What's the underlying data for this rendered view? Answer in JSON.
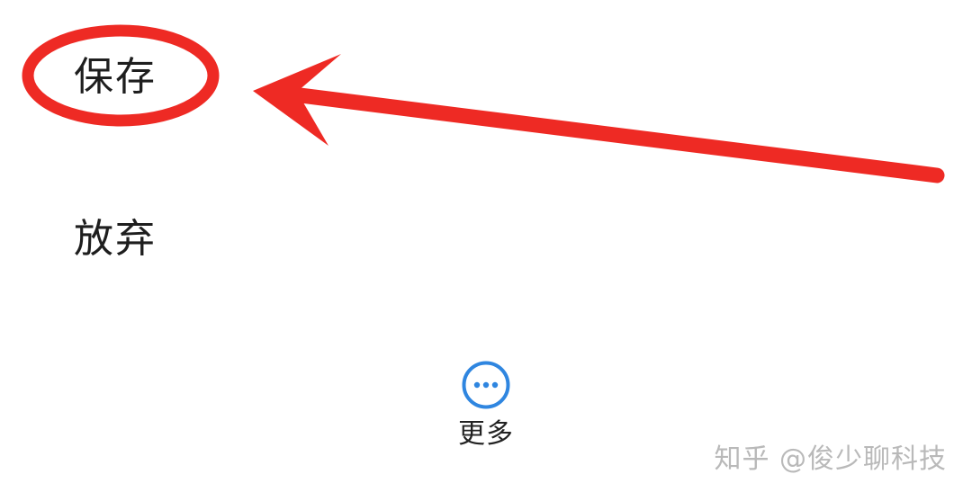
{
  "menu": {
    "save_label": "保存",
    "discard_label": "放弃"
  },
  "more": {
    "label": "更多",
    "icon": "more-horizontal-icon"
  },
  "watermark": {
    "text": "知乎 @俊少聊科技"
  },
  "colors": {
    "annotation_red": "#ee2a24",
    "accent_blue": "#2f86e0",
    "text": "#1e1e1e",
    "watermark": "#b9b9b9"
  }
}
